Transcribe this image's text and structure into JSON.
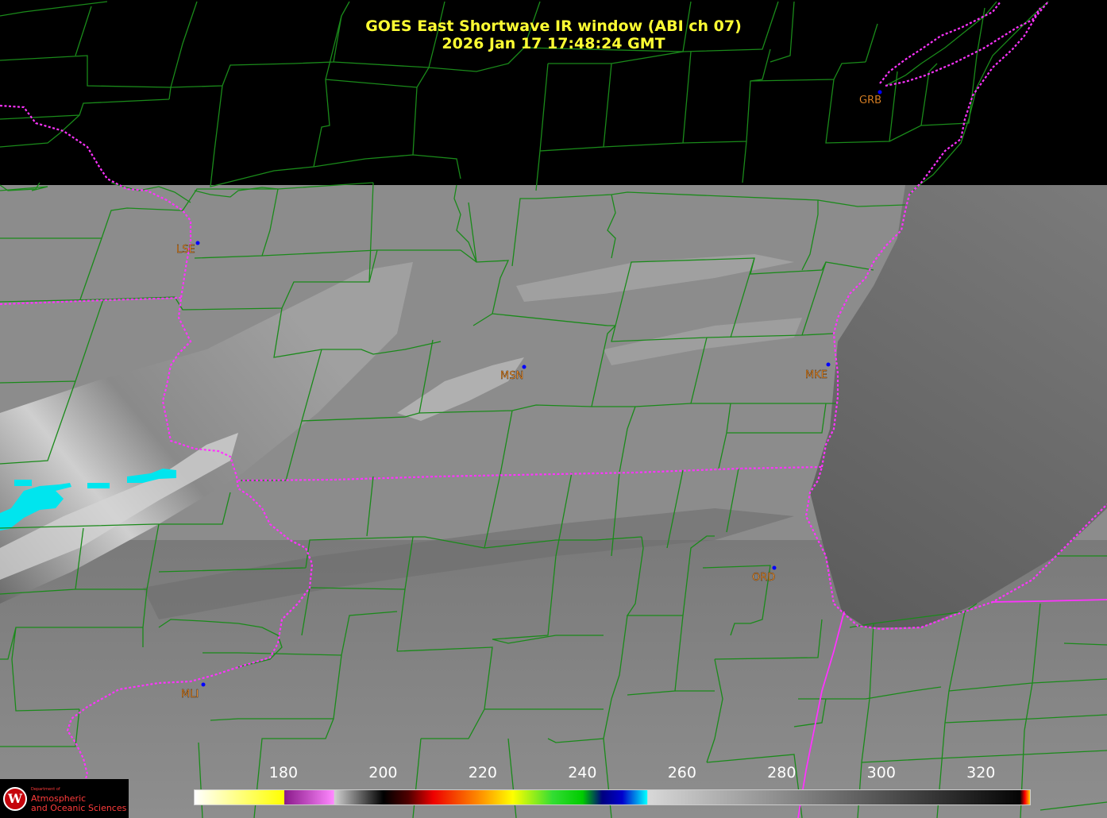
{
  "title": {
    "line1": "GOES East Shortwave IR window (ABI ch 07)",
    "line2": "2026 Jan 17  17:48:24 GMT"
  },
  "sites": [
    {
      "code": "GRB"
    },
    {
      "code": "LSE"
    },
    {
      "code": "MSN"
    },
    {
      "code": "MKE"
    },
    {
      "code": "ORD"
    },
    {
      "code": "MLI"
    }
  ],
  "colorbar": {
    "ticks": [
      "180",
      "200",
      "220",
      "240",
      "260",
      "280",
      "300",
      "320"
    ],
    "range": [
      162,
      330
    ],
    "stops": [
      {
        "t": 162,
        "color": "#ffffff"
      },
      {
        "t": 180,
        "color": "#ffff00"
      },
      {
        "t": 180.1,
        "color": "#8a1a8a"
      },
      {
        "t": 190,
        "color": "#ff88ff"
      },
      {
        "t": 190.1,
        "color": "#d0d0d0"
      },
      {
        "t": 200,
        "color": "#000000"
      },
      {
        "t": 205,
        "color": "#500000"
      },
      {
        "t": 210,
        "color": "#ee0000"
      },
      {
        "t": 220,
        "color": "#ff9900"
      },
      {
        "t": 226,
        "color": "#ffff00"
      },
      {
        "t": 234,
        "color": "#33dd33"
      },
      {
        "t": 240,
        "color": "#00cc00"
      },
      {
        "t": 244,
        "color": "#000080"
      },
      {
        "t": 248,
        "color": "#0000cc"
      },
      {
        "t": 253,
        "color": "#00ffff"
      },
      {
        "t": 253.1,
        "color": "#d8d8d8"
      },
      {
        "t": 328,
        "color": "#050505"
      },
      {
        "t": 329,
        "color": "#ff0000"
      },
      {
        "t": 330,
        "color": "#ffcc00"
      }
    ]
  },
  "logo": {
    "seal": "W",
    "dept": "Department of",
    "name_line1": "Atmospheric",
    "name_line2": "and Oceanic Sciences"
  },
  "colors": {
    "county_lines": "#1a8a1a",
    "state_lines": "#ff33ff",
    "title": "#ffff33",
    "site_label": "#ff9933",
    "site_marker": "#0000ff"
  }
}
